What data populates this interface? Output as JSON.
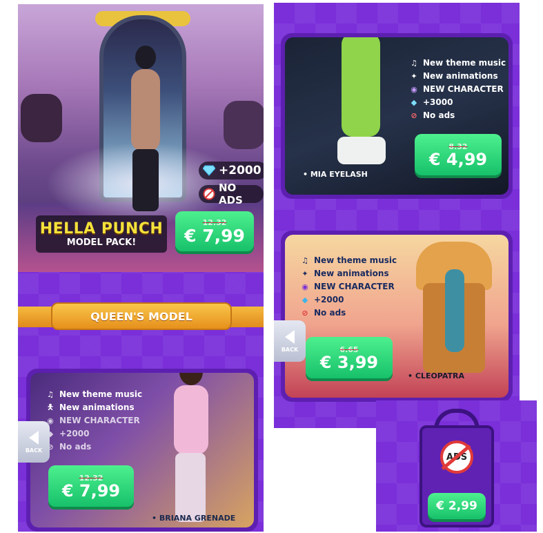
{
  "hella": {
    "diamonds": "+2000",
    "no_ads": "NO ADS",
    "title": "HELLA PUNCH",
    "subtitle": "MODEL PACK!",
    "old_price": "12.32",
    "price": "€ 7,99"
  },
  "queen": {
    "section_label": "QUEEN'S MODEL",
    "features": [
      "New theme music",
      "New animations",
      "NEW CHARACTER",
      "+2000",
      "No ads"
    ],
    "old_price": "12.32",
    "price": "€ 7,99",
    "character": "• BRIANA GRENADE",
    "back_label": "BACK"
  },
  "mia": {
    "features": [
      "New theme music",
      "New animations",
      "NEW CHARACTER",
      "+3000",
      "No ads"
    ],
    "old_price": "8.32",
    "price": "€ 4,99",
    "character": "• MIA EYELASH"
  },
  "cleo": {
    "features": [
      "New theme music",
      "New animations",
      "NEW CHARACTER",
      "+2000",
      "No ads"
    ],
    "old_price": "6.65",
    "price": "€ 3,99",
    "character": "• CLEOPATRA",
    "back_label": "BACK"
  },
  "noads": {
    "badge": "ADS",
    "price": "€ 2,99"
  },
  "colors": {
    "purple": "#7a2fd9",
    "green": "#17c16a",
    "gold": "#f4e23a",
    "orange": "#e6901c"
  }
}
